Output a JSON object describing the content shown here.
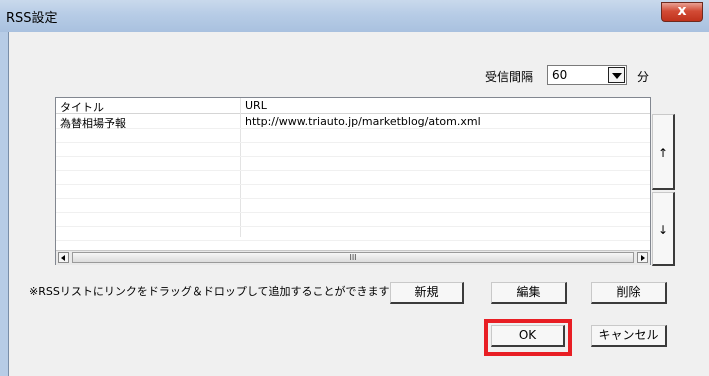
{
  "window": {
    "title": "RSS設定"
  },
  "close_icon_label": "x",
  "interval": {
    "label": "受信間隔",
    "value": "60",
    "unit": "分"
  },
  "table": {
    "columns": [
      "タイトル",
      "URL"
    ],
    "rows": [
      {
        "title": "為替相場予報",
        "url": "http://www.triauto.jp/marketblog/atom.xml"
      }
    ],
    "scroll_thumb_glyph": "III"
  },
  "side_buttons": {
    "up": "↑",
    "down": "↓"
  },
  "note": "※RSSリストにリンクをドラッグ＆ドロップして追加することができます",
  "buttons": {
    "new": "新規",
    "edit": "編集",
    "delete": "削除",
    "ok": "OK",
    "cancel": "キャンセル"
  },
  "colors": {
    "highlight": "#e81e24",
    "close_button": "#c9422c"
  }
}
